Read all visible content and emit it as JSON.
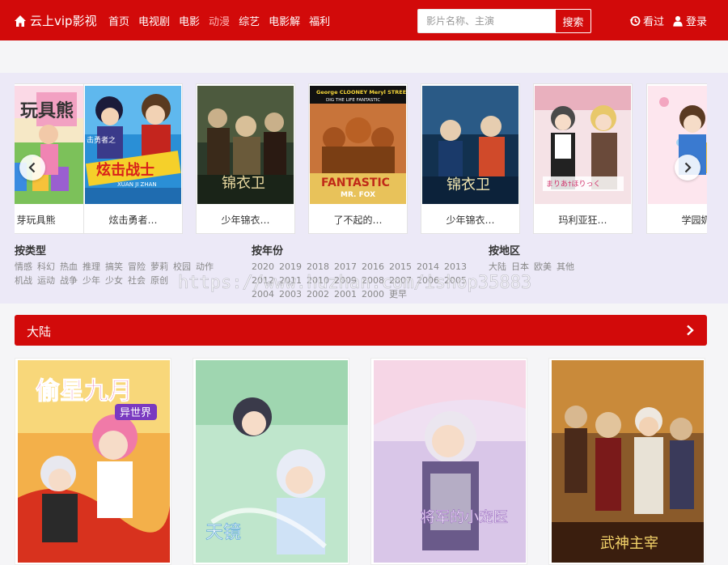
{
  "header": {
    "site_name": "云上vip影视",
    "nav": [
      "首页",
      "电视剧",
      "电影",
      "动漫",
      "综艺",
      "电影解",
      "福利"
    ],
    "active_nav": "动漫",
    "search_placeholder": "影片名称、主演",
    "search_button": "搜索",
    "history_label": "看过",
    "login_label": "登录"
  },
  "carousel": {
    "items": [
      {
        "title": "芽玩具熊",
        "icon": "poster-toy-bear"
      },
      {
        "title": "炫击勇者…",
        "icon": "poster-hero"
      },
      {
        "title": "少年锦衣…",
        "icon": "poster-jinyi"
      },
      {
        "title": "了不起的…",
        "icon": "poster-fantastic-fox"
      },
      {
        "title": "少年锦衣…",
        "icon": "poster-jinyi"
      },
      {
        "title": "玛利亚狂…",
        "icon": "poster-maria"
      },
      {
        "title": "学园奶",
        "icon": "poster-school"
      }
    ],
    "poster_texts": {
      "hero": "炫击战士",
      "hero_sub": "XUAN JI ZHAN",
      "hero_side": "击勇者之",
      "jinyi": "锦衣卫",
      "fox_actors": "George CLOONEY   Meryl STREEP",
      "fox_tag": "DIG THE LIFE FANTASTIC",
      "fox_title": "FANTASTIC",
      "fox_sub": "MR. FOX",
      "maria": "まりあ†ほりっく"
    }
  },
  "filters": {
    "type": {
      "label": "按类型",
      "options": [
        "情感",
        "科幻",
        "热血",
        "推理",
        "搞笑",
        "冒险",
        "萝莉",
        "校园",
        "动作",
        "机战",
        "运动",
        "战争",
        "少年",
        "少女",
        "社会",
        "原创"
      ]
    },
    "year": {
      "label": "按年份",
      "options": [
        "2020",
        "2019",
        "2018",
        "2017",
        "2016",
        "2015",
        "2014",
        "2013",
        "2012",
        "2011",
        "2010",
        "2009",
        "2008",
        "2007",
        "2006",
        "2005",
        "2004",
        "2003",
        "2002",
        "2001",
        "2000",
        "更早"
      ]
    },
    "region": {
      "label": "按地区",
      "options": [
        "大陆",
        "日本",
        "欧美",
        "其他"
      ]
    }
  },
  "watermark": "https://www.huzhan.com/ishop35883",
  "section": {
    "title": "大陆",
    "posters": [
      {
        "icon": "poster-toujin",
        "title": "偷星九月",
        "sub": "异世界"
      },
      {
        "icon": "poster-tianjing",
        "title": "天镜"
      },
      {
        "icon": "poster-jiangjun",
        "title": "将军的小宠医"
      },
      {
        "icon": "poster-wulin",
        "title": "武神主宰"
      }
    ]
  },
  "colors": {
    "brand": "#d20a0a",
    "hero_bg": "#ece9f7"
  }
}
